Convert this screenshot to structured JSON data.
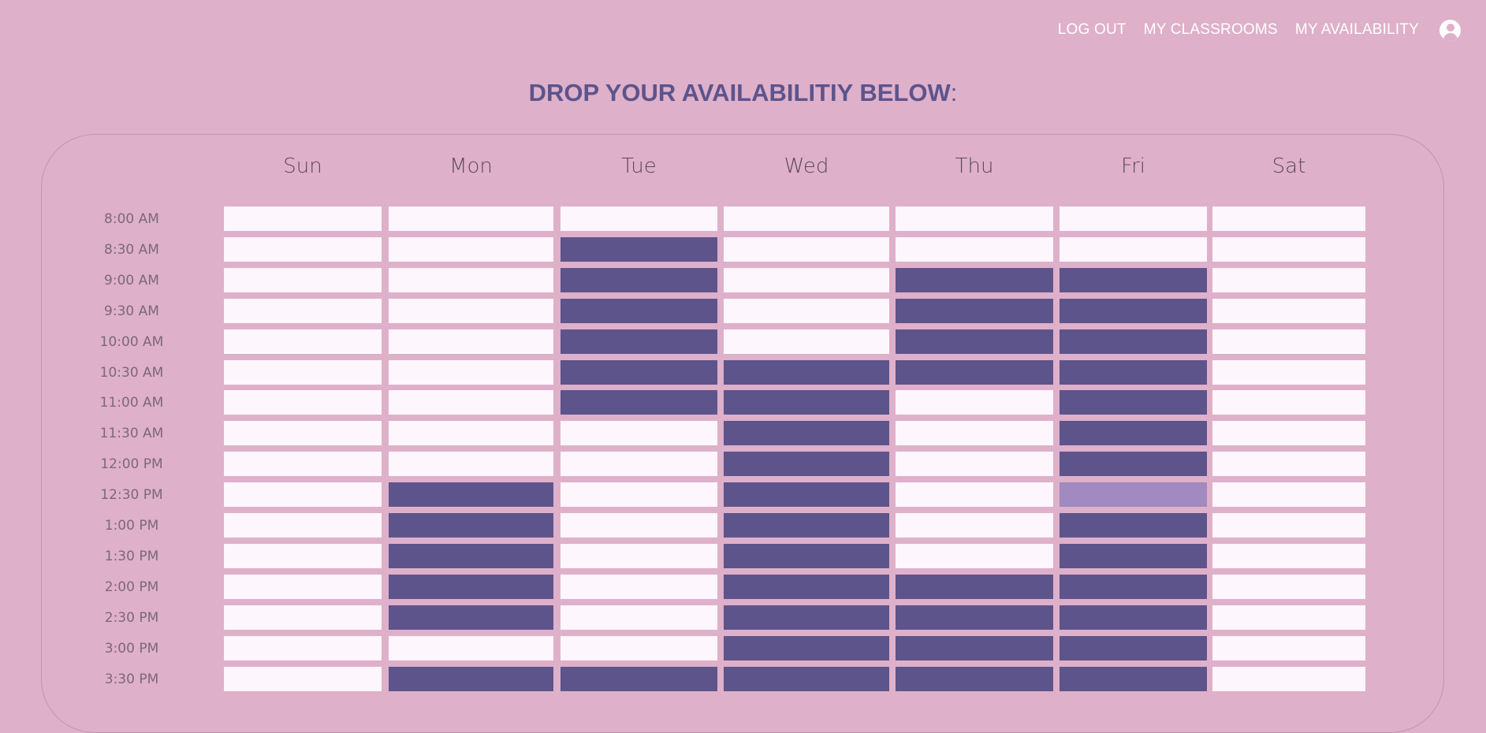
{
  "nav": {
    "logout": "LOG OUT",
    "classrooms": "MY CLASSROOMS",
    "availability": "MY AVAILABILITY",
    "profile_icon": "user-circle-icon"
  },
  "page_title": "DROP YOUR AVAILABILITIY BELOW",
  "page_title_colon": ":",
  "days": [
    "Sun",
    "Mon",
    "Tue",
    "Wed",
    "Thu",
    "Fri",
    "Sat"
  ],
  "times": [
    "8:00 AM",
    "8:30 AM",
    "9:00 AM",
    "9:30 AM",
    "10:00 AM",
    "10:30 AM",
    "11:00 AM",
    "11:30 AM",
    "12:00 PM",
    "12:30 PM",
    "1:00 PM",
    "1:30 PM",
    "2:00 PM",
    "2:30 PM",
    "3:00 PM",
    "3:30 PM"
  ],
  "availability": [
    [
      0,
      0,
      0,
      0,
      0,
      0,
      0
    ],
    [
      0,
      0,
      1,
      0,
      0,
      0,
      0
    ],
    [
      0,
      0,
      1,
      0,
      1,
      1,
      0
    ],
    [
      0,
      0,
      1,
      0,
      1,
      1,
      0
    ],
    [
      0,
      0,
      1,
      0,
      1,
      1,
      0
    ],
    [
      0,
      0,
      1,
      1,
      1,
      1,
      0
    ],
    [
      0,
      0,
      1,
      1,
      0,
      1,
      0
    ],
    [
      0,
      0,
      0,
      1,
      0,
      1,
      0
    ],
    [
      0,
      0,
      0,
      1,
      0,
      1,
      0
    ],
    [
      0,
      1,
      0,
      1,
      0,
      2,
      0
    ],
    [
      0,
      1,
      0,
      1,
      0,
      1,
      0
    ],
    [
      0,
      1,
      0,
      1,
      0,
      1,
      0
    ],
    [
      0,
      1,
      0,
      1,
      1,
      1,
      0
    ],
    [
      0,
      1,
      0,
      1,
      1,
      1,
      0
    ],
    [
      0,
      0,
      0,
      1,
      1,
      1,
      0
    ],
    [
      0,
      1,
      1,
      1,
      1,
      1,
      0
    ]
  ],
  "colors": {
    "background": "#dfb0ca",
    "available": "#5d548b",
    "hover": "#a08abf",
    "empty": "#fdf6fd",
    "title": "#5c548c"
  }
}
